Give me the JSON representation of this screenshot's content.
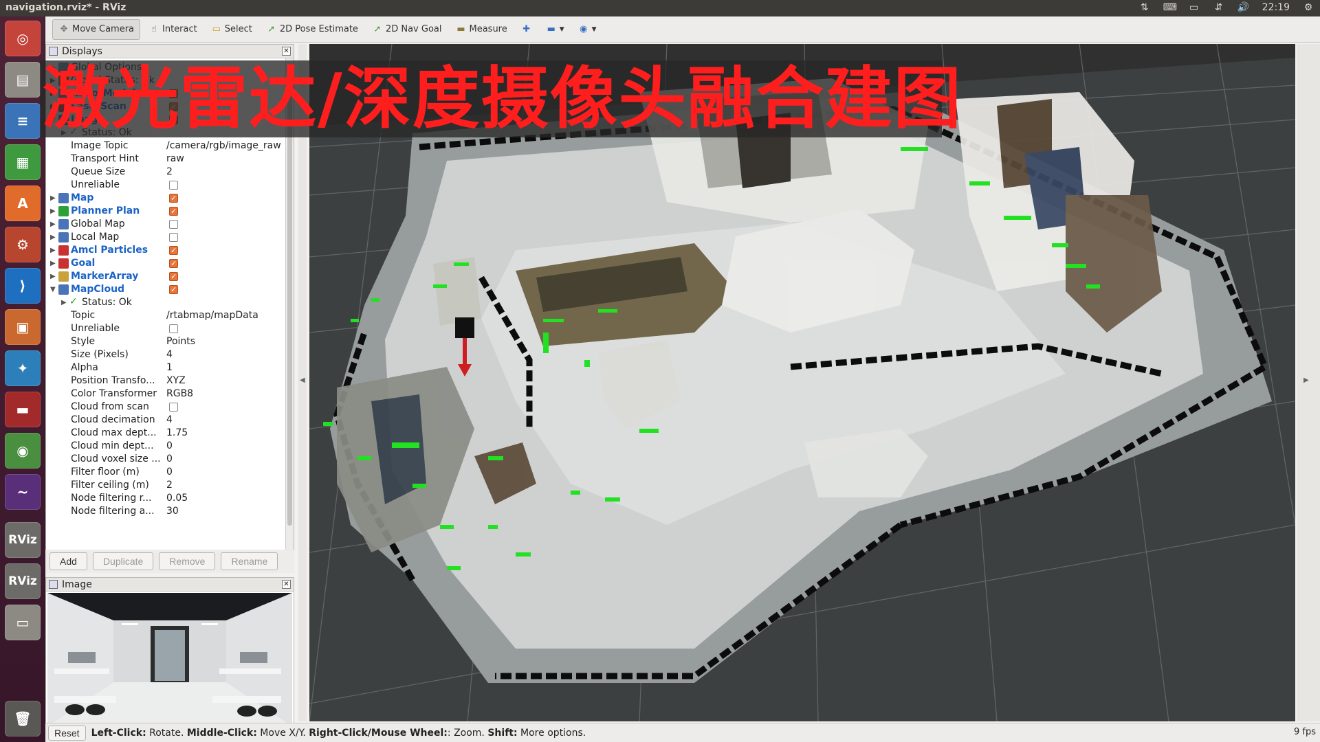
{
  "window": {
    "title": "navigation.rviz* - RViz",
    "clock": "22:19"
  },
  "overlay_title": "激光雷达/深度摄像头融合建图",
  "toolbar": {
    "move_camera": "Move Camera",
    "interact": "Interact",
    "select": "Select",
    "pose_estimate": "2D Pose Estimate",
    "nav_goal": "2D Nav Goal",
    "measure": "Measure"
  },
  "displays_panel": {
    "title": "Displays",
    "rows": [
      {
        "name": "Global Options",
        "value": "",
        "check": null
      },
      {
        "name": "Global Status: Ok",
        "value": "",
        "check": null
      },
      {
        "name": "RobotModel",
        "value": "",
        "check": true
      },
      {
        "name": "LaserScan",
        "value": "",
        "check": true
      },
      {
        "name": "Image",
        "value": "",
        "check": true
      },
      {
        "name": "Status: Ok",
        "value": "",
        "check": null
      },
      {
        "name": "Image Topic",
        "value": "/camera/rgb/image_raw",
        "check": null
      },
      {
        "name": "Transport Hint",
        "value": "raw",
        "check": null
      },
      {
        "name": "Queue Size",
        "value": "2",
        "check": null
      },
      {
        "name": "Unreliable",
        "value": "",
        "check": false
      },
      {
        "name": "Map",
        "value": "",
        "check": true
      },
      {
        "name": "Planner Plan",
        "value": "",
        "check": true
      },
      {
        "name": "Global Map",
        "value": "",
        "check": false
      },
      {
        "name": "Local Map",
        "value": "",
        "check": false
      },
      {
        "name": "Amcl Particles",
        "value": "",
        "check": true
      },
      {
        "name": "Goal",
        "value": "",
        "check": true
      },
      {
        "name": "MarkerArray",
        "value": "",
        "check": true
      },
      {
        "name": "MapCloud",
        "value": "",
        "check": true
      },
      {
        "name": "Status: Ok",
        "value": "",
        "check": null
      },
      {
        "name": "Topic",
        "value": "/rtabmap/mapData",
        "check": null
      },
      {
        "name": "Unreliable",
        "value": "",
        "check": false
      },
      {
        "name": "Style",
        "value": "Points",
        "check": null
      },
      {
        "name": "Size (Pixels)",
        "value": "4",
        "check": null
      },
      {
        "name": "Alpha",
        "value": "1",
        "check": null
      },
      {
        "name": "Position Transfo...",
        "value": "XYZ",
        "check": null
      },
      {
        "name": "Color Transformer",
        "value": "RGB8",
        "check": null
      },
      {
        "name": "Cloud from scan",
        "value": "",
        "check": false
      },
      {
        "name": "Cloud decimation",
        "value": "4",
        "check": null
      },
      {
        "name": "Cloud max dept...",
        "value": "1.75",
        "check": null
      },
      {
        "name": "Cloud min dept...",
        "value": "0",
        "check": null
      },
      {
        "name": "Cloud voxel size ...",
        "value": "0",
        "check": null
      },
      {
        "name": "Filter floor (m)",
        "value": "0",
        "check": null
      },
      {
        "name": "Filter ceiling (m)",
        "value": "2",
        "check": null
      },
      {
        "name": "Node filtering r...",
        "value": "0.05",
        "check": null
      },
      {
        "name": "Node filtering a...",
        "value": "30",
        "check": null
      }
    ],
    "buttons": {
      "add": "Add",
      "duplicate": "Duplicate",
      "remove": "Remove",
      "rename": "Rename"
    }
  },
  "image_panel": {
    "title": "Image"
  },
  "statusbar": {
    "reset": "Reset",
    "left_click": "Left-Click:",
    "left_click_desc": "Rotate.",
    "middle_click": "Middle-Click:",
    "middle_click_desc": "Move X/Y.",
    "right_click": "Right-Click/Mouse Wheel:",
    "right_click_desc": ": Zoom.",
    "shift": "Shift:",
    "shift_desc": "More options.",
    "fps": "9 fps"
  }
}
